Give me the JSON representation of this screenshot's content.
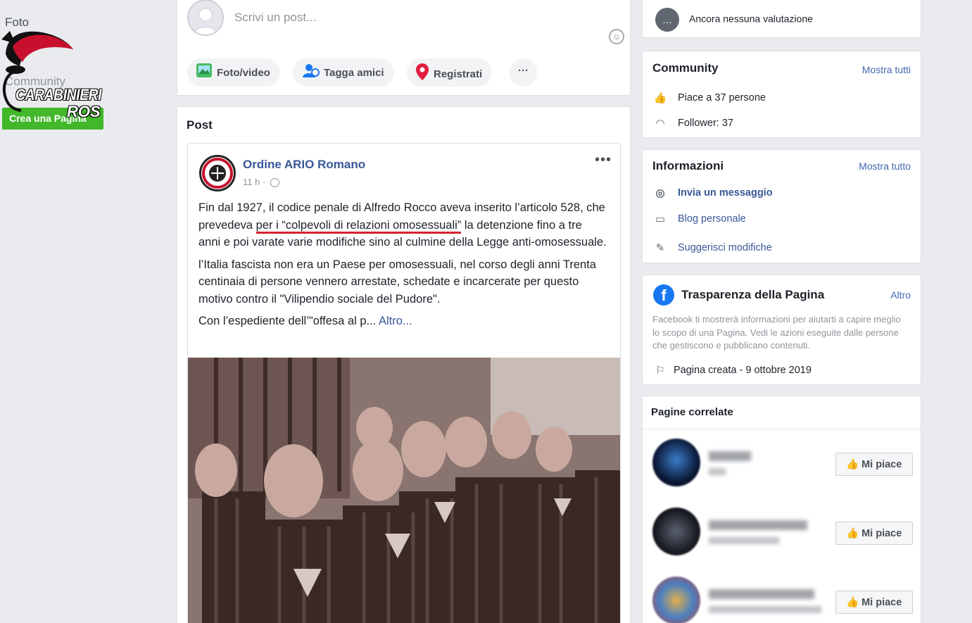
{
  "sidebar": {
    "items": [
      "Foto",
      "Community",
      "Crea una Pagina"
    ],
    "logo_line1": "CARABINIERI",
    "logo_line2": "ROS"
  },
  "composer": {
    "placeholder": "Scrivi un post...",
    "actions": [
      "Foto/video",
      "Tagga amici",
      "Registrati",
      "···"
    ]
  },
  "posts": {
    "section_title": "Post",
    "post": {
      "author": "Ordine ARIO Romano",
      "time": "11 h ·",
      "para1_a": "Fin dal 1927, il codice penale di Alfredo Rocco aveva inserito l’articolo 528, che prevedeva ",
      "para1_underlined": "per i “colpevoli di relazioni omosessuali”",
      "para1_b": " la detenzione fino a tre anni e poi varate varie modifiche sino al culmine della Legge anti-omosessuale.",
      "para2": "l’Italia fascista non era un Paese per omosessuali, nel corso degli anni Trenta centinaia di persone vennero arrestate, schedate e incarcerate per questo motivo contro il \"Vilipendio sociale del Pudore\".",
      "para3": "Con l’espediente dell’\"offesa al p...",
      "more_link": "Altro..."
    }
  },
  "right": {
    "rating": "Ancora nessuna valutazione",
    "community": {
      "title": "Community",
      "link": "Mostra tutti",
      "likes": "Piace a 37 persone",
      "followers": "Follower: 37"
    },
    "info": {
      "title": "Informazioni",
      "link": "Mostra tutto",
      "items": [
        "Invia un messaggio",
        "Blog personale",
        "Suggerisci modifiche"
      ]
    },
    "transparency": {
      "title": "Trasparenza della Pagina",
      "link": "Altro",
      "desc": "Facebook ti mostrerà informazioni per aiutarti a capire meglio lo scopo di una Pagina. Vedi le azioni eseguite dalle persone che gestiscono e pubblicano contenuti.",
      "created": "Pagina creata - 9 ottobre 2019"
    },
    "related": {
      "title": "Pagine correlate",
      "like_label": "Mi piace"
    }
  },
  "colors": {
    "facebook_blue": "#385898",
    "green": "#42b72a",
    "underline_red": "#d3242f"
  }
}
